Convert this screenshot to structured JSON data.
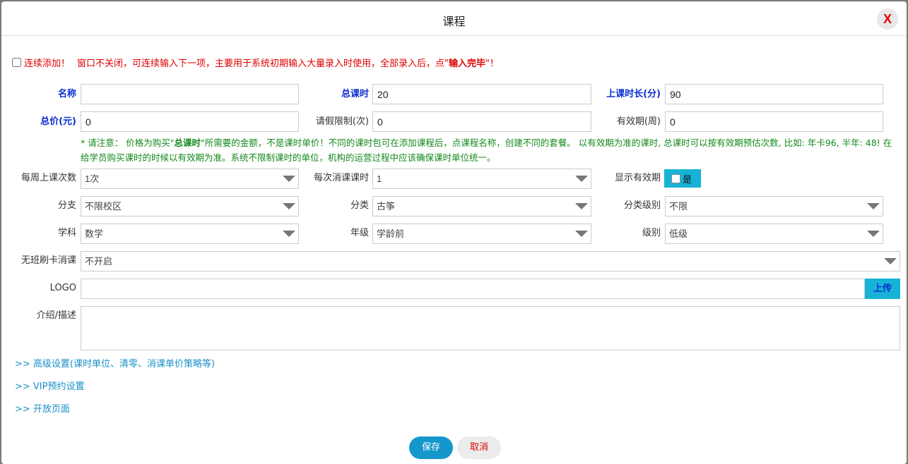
{
  "dialog": {
    "title": "课程",
    "close_label": "X"
  },
  "notice": {
    "checkbox_label": "连续添加！",
    "text_part1": "窗口不关闭，可连续输入下一项，主要用于系统初期输入大量录入时使用，全部录入后，点\"",
    "text_strong": "输入完毕",
    "text_part2": "\"！"
  },
  "row1": {
    "name_label": "名称",
    "name_value": "",
    "total_hours_label": "总课时",
    "total_hours_value": "20",
    "duration_label": "上课时长(分)",
    "duration_value": "90"
  },
  "row2": {
    "price_label": "总价(元)",
    "price_value": "0",
    "leave_label": "请假限制(次)",
    "leave_value": "0",
    "validity_label": "有效期(周)",
    "validity_value": "0"
  },
  "hint": {
    "part1": "* 请注意：  价格为购买\"",
    "strong": "总课时",
    "part2": "\"所需要的金额，不是课时单价！不同的课时包可在添加课程后，点课程名称，创建不同的套餐。 以有效期为准的课时, 总课时可以按有效期预估次数, 比如: 年卡96, 半年: 48! 在给学员购买课时的时候以有效期为准。系统不限制课时的单位，机构的运营过程中应该确保课时单位统一。"
  },
  "row3": {
    "weekly_label": "每周上课次数",
    "weekly_value": "1次",
    "per_class_label": "每次消课课时",
    "per_class_value": "1",
    "show_validity_label": "显示有效期",
    "show_validity_option": "是"
  },
  "row4": {
    "branch_label": "分支",
    "branch_value": "不限校区",
    "category_label": "分类",
    "category_value": "古筝",
    "category_level_label": "分类级别",
    "category_level_value": "不限"
  },
  "row5": {
    "subject_label": "学科",
    "subject_value": "数学",
    "grade_label": "年级",
    "grade_value": "学龄前",
    "level_label": "级别",
    "level_value": "低级"
  },
  "row6": {
    "swipe_label": "无班刷卡消课",
    "swipe_value": "不开启"
  },
  "row7": {
    "logo_label": "LOGO",
    "logo_value": "",
    "upload_label": "上传"
  },
  "row8": {
    "desc_label": "介绍/描述",
    "desc_value": ""
  },
  "links": {
    "advanced": ">> 高级设置(课时单位、清零、消课单价策略等)",
    "vip": ">> VIP预约设置",
    "open_page": ">> 开放页面"
  },
  "footer": {
    "save_label": "保存",
    "cancel_label": "取消"
  },
  "colors": {
    "accent": "#17b3d6",
    "save": "#1697cc",
    "label_blue": "#0a2fd0",
    "warning_red": "#e00000",
    "hint_green": "#14891c"
  }
}
